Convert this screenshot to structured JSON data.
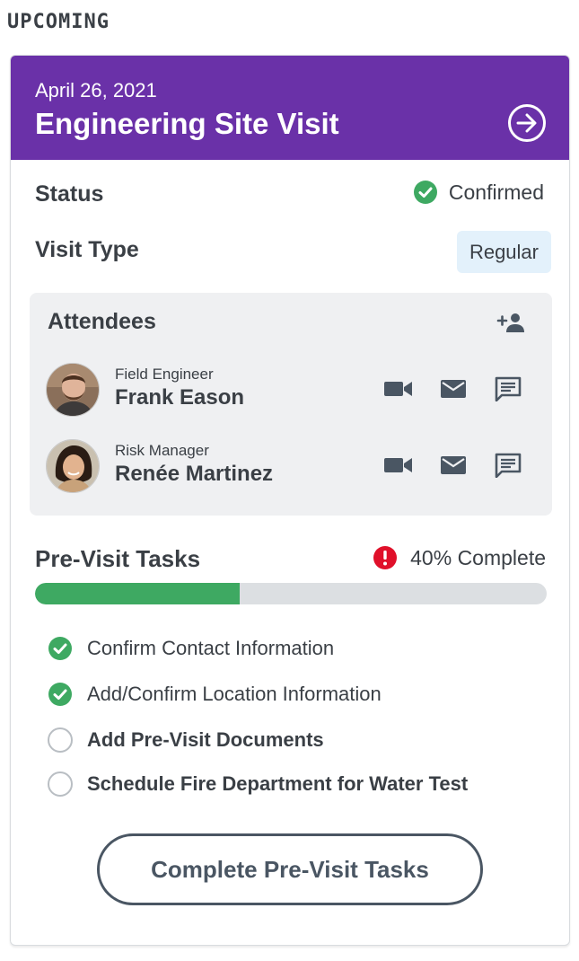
{
  "section_label": "UPCOMING",
  "visit": {
    "date": "April 26, 2021",
    "title": "Engineering Site Visit",
    "status_label": "Status",
    "status_value": "Confirmed",
    "type_label": "Visit Type",
    "type_value": "Regular"
  },
  "attendees": {
    "title": "Attendees",
    "people": [
      {
        "role": "Field Engineer",
        "name": "Frank Eason"
      },
      {
        "role": "Risk Manager",
        "name": "Renée Martinez"
      }
    ]
  },
  "tasks": {
    "title": "Pre-Visit Tasks",
    "progress_label": "40% Complete",
    "progress_percent": 40,
    "items": [
      {
        "label": "Confirm Contact Information",
        "done": true
      },
      {
        "label": "Add/Confirm Location Information",
        "done": true
      },
      {
        "label": "Add Pre-Visit Documents",
        "done": false
      },
      {
        "label": "Schedule Fire Department for Water Test",
        "done": false
      }
    ],
    "button_label": "Complete Pre-Visit Tasks"
  },
  "colors": {
    "header": "#6a31a8",
    "success": "#3ea962",
    "alert": "#e0102a",
    "badge_bg": "#e3f1fb",
    "panel_bg": "#eff0f2",
    "icon_gray": "#4a5663"
  },
  "icons": {
    "header": "arrow-circle-right-icon",
    "status": "check-circle-icon",
    "add_attendee": "person-add-icon",
    "attendee_actions": [
      "video-camera-icon",
      "mail-icon",
      "message-icon"
    ],
    "tasks_status": "alert-circle-icon"
  }
}
